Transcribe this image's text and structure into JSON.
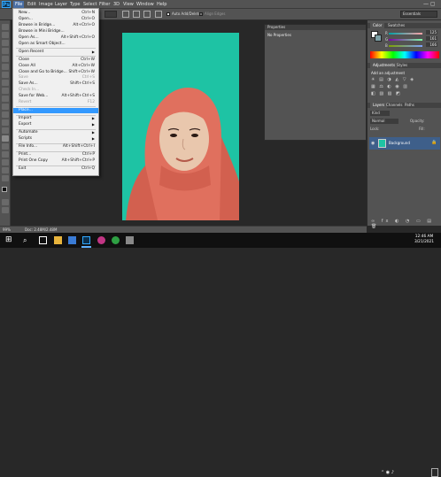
{
  "app": {
    "logo": "Ps"
  },
  "menubar": {
    "items": [
      "File",
      "Edit",
      "Image",
      "Layer",
      "Type",
      "Select",
      "Filter",
      "3D",
      "View",
      "Window",
      "Help"
    ],
    "active": "File"
  },
  "options": {
    "auto_add_delete": "Auto Add/Delete",
    "align_edges": "Align Edges",
    "workspace": "Essentials"
  },
  "file_menu": {
    "items": [
      {
        "label": "New...",
        "shortcut": "Ctrl+N",
        "disabled": false
      },
      {
        "label": "Open...",
        "shortcut": "Ctrl+O",
        "disabled": false
      },
      {
        "label": "Browse in Bridge...",
        "shortcut": "Alt+Ctrl+O",
        "disabled": false
      },
      {
        "label": "Browse in Mini Bridge...",
        "shortcut": "",
        "disabled": false
      },
      {
        "label": "Open As...",
        "shortcut": "Alt+Shift+Ctrl+O",
        "disabled": false
      },
      {
        "label": "Open as Smart Object...",
        "shortcut": "",
        "disabled": false
      },
      {
        "label": "Open Recent",
        "shortcut": "",
        "disabled": false,
        "submenu": true
      },
      {
        "label": "Close",
        "shortcut": "Ctrl+W",
        "disabled": false
      },
      {
        "label": "Close All",
        "shortcut": "Alt+Ctrl+W",
        "disabled": false
      },
      {
        "label": "Close and Go to Bridge...",
        "shortcut": "Shift+Ctrl+W",
        "disabled": false
      },
      {
        "label": "Save",
        "shortcut": "Ctrl+S",
        "disabled": true
      },
      {
        "label": "Save As...",
        "shortcut": "Shift+Ctrl+S",
        "disabled": false
      },
      {
        "label": "Check In...",
        "shortcut": "",
        "disabled": true
      },
      {
        "label": "Save for Web...",
        "shortcut": "Alt+Shift+Ctrl+S",
        "disabled": false
      },
      {
        "label": "Revert",
        "shortcut": "F12",
        "disabled": true
      },
      {
        "label": "Place...",
        "shortcut": "",
        "disabled": false,
        "highlight": true
      },
      {
        "label": "Import",
        "shortcut": "",
        "disabled": false,
        "submenu": true
      },
      {
        "label": "Export",
        "shortcut": "",
        "disabled": false,
        "submenu": true
      },
      {
        "label": "Automate",
        "shortcut": "",
        "disabled": false,
        "submenu": true
      },
      {
        "label": "Scripts",
        "shortcut": "",
        "disabled": false,
        "submenu": true
      },
      {
        "label": "File Info...",
        "shortcut": "Alt+Shift+Ctrl+I",
        "disabled": false
      },
      {
        "label": "Print...",
        "shortcut": "Ctrl+P",
        "disabled": false
      },
      {
        "label": "Print One Copy",
        "shortcut": "Alt+Shift+Ctrl+P",
        "disabled": false
      },
      {
        "label": "Exit",
        "shortcut": "Ctrl+Q",
        "disabled": false
      }
    ]
  },
  "properties_panel": {
    "title": "Properties",
    "body": "No Properties"
  },
  "right_panels": {
    "color_tabs": [
      "Color",
      "Swatches"
    ],
    "channels": [
      {
        "label": "R",
        "value": "125"
      },
      {
        "label": "G",
        "value": "161"
      },
      {
        "label": "B",
        "value": "166"
      }
    ],
    "adjust_tabs": [
      "Adjustments",
      "Styles"
    ],
    "adjust_title": "Add an adjustment",
    "layers_tabs": [
      "Layers",
      "Channels",
      "Paths"
    ],
    "kind_label": "Kind",
    "blend_mode": "Normal",
    "opacity_label": "Opacity:",
    "lock_label": "Lock:",
    "fill_label": "Fill:",
    "layer_name": "Background"
  },
  "status": {
    "zoom": "99%",
    "doc": "Doc: 2.48M/2.48M"
  },
  "taskbar": {
    "time": "12:46 AM",
    "date": "3/21/2021"
  },
  "colors": {
    "accent": "#3399ff",
    "bg": "#1ec3a4",
    "hijab": "#e0705e"
  }
}
